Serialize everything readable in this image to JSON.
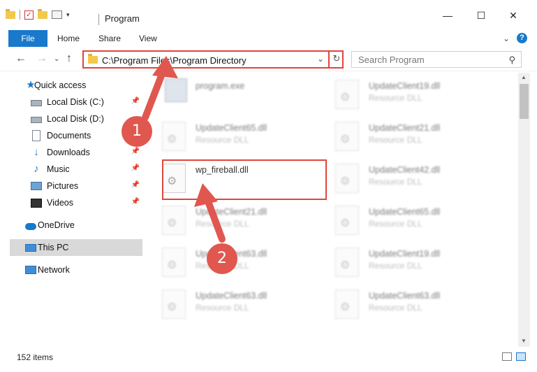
{
  "window": {
    "title": "Program",
    "minimize_icon": "minimize-icon",
    "maximize_icon": "maximize-icon",
    "close_icon": "close-icon"
  },
  "ribbon": {
    "file_label": "File",
    "tabs": [
      "Home",
      "Share",
      "View"
    ]
  },
  "nav": {
    "address": "C:\\Program Files\\Program Directory",
    "search_placeholder": "Search Program"
  },
  "sidebar": {
    "items": [
      {
        "label": "Quick access",
        "icon": "star-icon"
      },
      {
        "label": "Local Disk (C:)",
        "icon": "drive-icon",
        "pinned": true
      },
      {
        "label": "Local Disk (D:)",
        "icon": "drive-icon"
      },
      {
        "label": "Documents",
        "icon": "documents-icon"
      },
      {
        "label": "Downloads",
        "icon": "download-icon",
        "pinned": true
      },
      {
        "label": "Music",
        "icon": "music-icon",
        "pinned": true
      },
      {
        "label": "Pictures",
        "icon": "pictures-icon",
        "pinned": true
      },
      {
        "label": "Videos",
        "icon": "videos-icon",
        "pinned": true
      },
      {
        "label": "OneDrive",
        "icon": "cloud-icon"
      },
      {
        "label": "This PC",
        "icon": "computer-icon",
        "selected": true
      },
      {
        "label": "Network",
        "icon": "network-icon"
      }
    ]
  },
  "files": {
    "left": [
      {
        "name": "program.exe",
        "type": ""
      },
      {
        "name": "UpdateClient65.dll",
        "type": "Resource DLL"
      },
      {
        "name": "wp_fireball.dll",
        "type": ""
      },
      {
        "name": "UpdateClient21.dll",
        "type": "Resource DLL"
      },
      {
        "name": "UpdateClient63.dll",
        "type": "Resource DLL"
      },
      {
        "name": "UpdateClient63.dll",
        "type": "Resource DLL"
      }
    ],
    "right": [
      {
        "name": "UpdateClient19.dll",
        "type": "Resource DLL"
      },
      {
        "name": "UpdateClient21.dll",
        "type": "Resource DLL"
      },
      {
        "name": "UpdateClient42.dll",
        "type": "Resource DLL"
      },
      {
        "name": "UpdateClient65.dll",
        "type": "Resource DLL"
      },
      {
        "name": "UpdateClient19.dll",
        "type": "Resource DLL"
      },
      {
        "name": "UpdateClient63.dll",
        "type": "Resource DLL"
      }
    ]
  },
  "status": {
    "item_count": "152 items"
  },
  "annotations": {
    "badge1": "1",
    "badge2": "2",
    "color": "#e05750"
  }
}
